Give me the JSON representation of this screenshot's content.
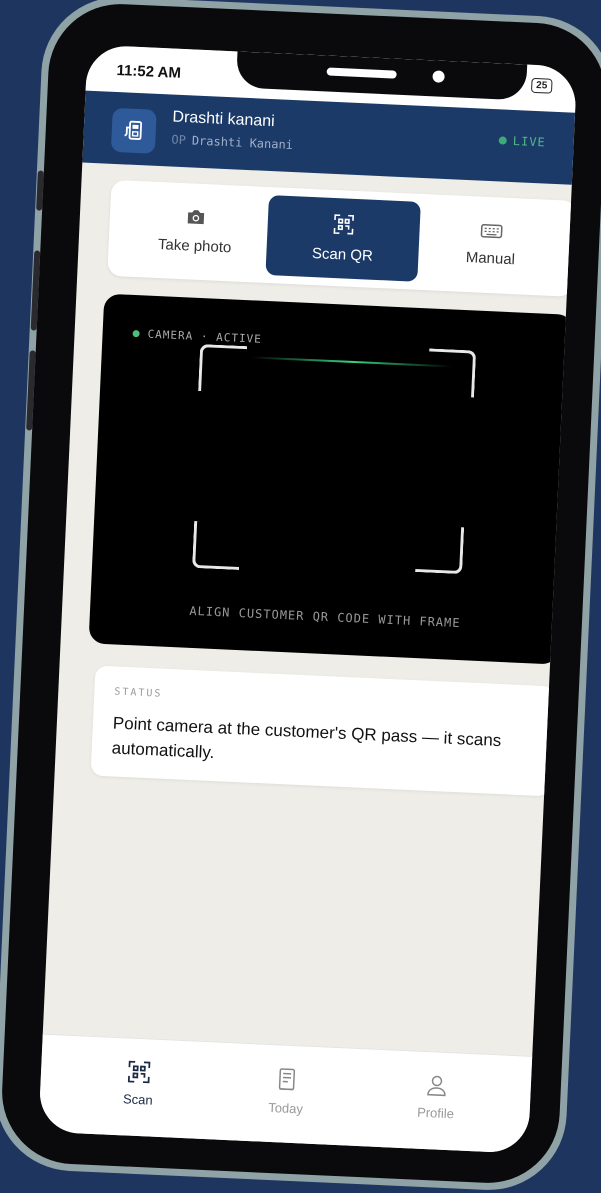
{
  "status_bar": {
    "time": "11:52 AM",
    "battery": "25"
  },
  "header": {
    "name": "Drashti kanani",
    "op_prefix": "OP",
    "op_name": "Drashti Kanani",
    "live": "LIVE"
  },
  "tabs": [
    {
      "label": "Take photo",
      "icon": "camera-icon"
    },
    {
      "label": "Scan QR",
      "icon": "qr-code-icon",
      "active": true
    },
    {
      "label": "Manual",
      "icon": "keyboard-icon"
    }
  ],
  "camera": {
    "label": "CAMERA · ACTIVE",
    "instruction": "ALIGN CUSTOMER QR CODE WITH FRAME"
  },
  "status": {
    "label": "STATUS",
    "text": "Point camera at the customer's QR pass — it scans automatically."
  },
  "nav": [
    {
      "label": "Scan",
      "icon": "qr-code-icon",
      "active": true
    },
    {
      "label": "Today",
      "icon": "receipt-icon"
    },
    {
      "label": "Profile",
      "icon": "person-icon"
    }
  ],
  "colors": {
    "brand": "#1b3a68",
    "live": "#3daa78",
    "background": "#1e3560"
  }
}
